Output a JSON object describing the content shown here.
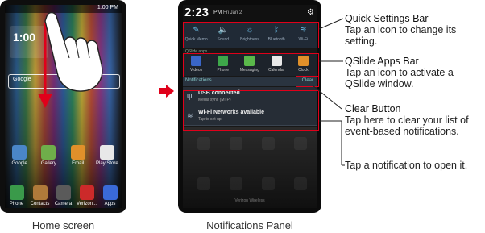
{
  "left_phone": {
    "status_time": "1:00 PM",
    "widget_text": "1:00",
    "search_label": "Google",
    "apps_row1": [
      {
        "label": "Google",
        "color": "#4a86c8"
      },
      {
        "label": "Gallery",
        "color": "#6fae4a"
      },
      {
        "label": "Email",
        "color": "#e0902a"
      },
      {
        "label": "Play Store",
        "color": "#e8e8e8"
      }
    ],
    "apps_row2": [
      {
        "label": "Phone",
        "color": "#3a9a4a"
      },
      {
        "label": "Contacts",
        "color": "#b07a3a"
      },
      {
        "label": "Camera",
        "color": "#5a5a5a"
      },
      {
        "label": "Verizon...",
        "color": "#cc2a2a"
      },
      {
        "label": "Apps",
        "color": "#3a6ad8"
      }
    ],
    "caption": "Home screen"
  },
  "right_phone": {
    "time": "2:23",
    "ampm": "PM",
    "date": "Fri Jan 2",
    "quick_settings": [
      {
        "label": "Quick Memo",
        "icon": "quickmemo-icon",
        "glyph": "✎"
      },
      {
        "label": "Sound",
        "icon": "sound-icon",
        "glyph": "🔈"
      },
      {
        "label": "Brightness",
        "icon": "brightness-icon",
        "glyph": "☼"
      },
      {
        "label": "Bluetooth",
        "icon": "bluetooth-icon",
        "glyph": "ᛒ"
      },
      {
        "label": "Wi-Fi",
        "icon": "wifi-icon",
        "glyph": "≋"
      }
    ],
    "qslide_title": "QSlide apps",
    "qslide_apps": [
      {
        "label": "Videos",
        "color": "#3a66c8"
      },
      {
        "label": "Phone",
        "color": "#3ea84a"
      },
      {
        "label": "Messaging",
        "color": "#5ab84a"
      },
      {
        "label": "Calendar",
        "color": "#e8e8e8"
      },
      {
        "label": "Clock",
        "color": "#e0902a"
      }
    ],
    "notifications_label": "Notifications",
    "clear_label": "Clear",
    "notifications": [
      {
        "title": "USB connected",
        "subtitle": "Media sync (MTP)",
        "icon": "usb-icon",
        "glyph": "ψ"
      },
      {
        "title": "Wi-Fi Networks available",
        "subtitle": "Tap to set up",
        "icon": "wifi-networks-icon",
        "glyph": "≋"
      }
    ],
    "carrier": "Verizon Wireless",
    "caption": "Notifications Panel"
  },
  "callouts": {
    "quick_settings": {
      "title": "Quick Settings Bar",
      "body": [
        "Tap an icon to change its",
        "setting."
      ]
    },
    "qslide": {
      "title": "QSlide Apps Bar",
      "body": [
        "Tap an icon to activate a",
        "QSlide window."
      ]
    },
    "clear": {
      "title": "Clear Button",
      "body": [
        "Tap here to clear your list of",
        "event-based notifications."
      ]
    },
    "notification": {
      "body": [
        "Tap a notification to open it."
      ]
    }
  },
  "colors": {
    "highlight": "#e0001a",
    "arrow": "#e0001a"
  }
}
